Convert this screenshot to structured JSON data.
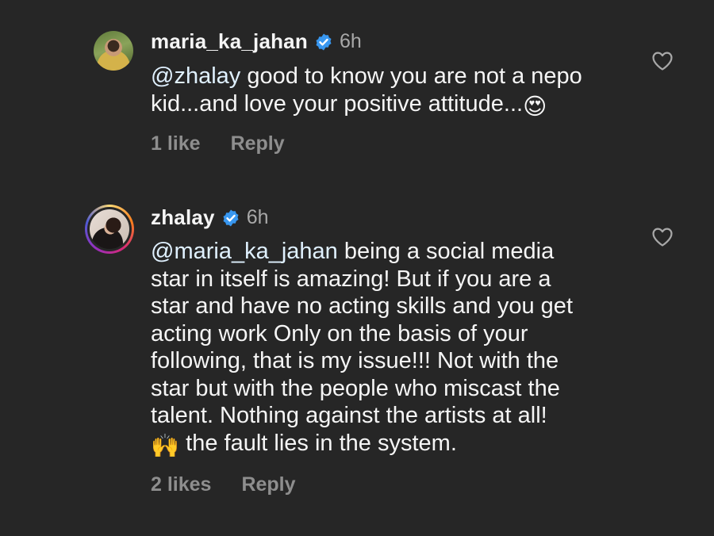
{
  "comments": [
    {
      "username": "maria_ka_jahan",
      "time": "6h",
      "mention": "@zhalay",
      "line1_rest": " good to know you are not a nepo",
      "line2": "kid...and love your positive attitude...",
      "emoji": "😍",
      "likes": "1 like",
      "reply": "Reply",
      "avatar_icon": "profile-photo",
      "heart_icon": "heart-outline-icon"
    },
    {
      "username": "zhalay",
      "time": "6h",
      "mention": "@maria_ka_jahan",
      "line1_rest": " being a social media",
      "lines": [
        "star in itself is amazing! But if you are a",
        "star and have no acting skills and you get",
        "acting work Only on the basis of your",
        "following, that is my issue!!! Not with the",
        "star but with the people who miscast the",
        "talent. Nothing against the artists at all!"
      ],
      "emoji": "🙌",
      "last_line": " the fault lies in the system.",
      "likes": "2 likes",
      "reply": "Reply",
      "avatar_icon": "profile-photo-story-ring",
      "heart_icon": "heart-outline-icon"
    }
  ],
  "colors": {
    "background": "#262626",
    "text": "#f5f5f5",
    "mention": "#e0f1ff",
    "secondary": "#8e8e8e",
    "verified": "#3897f0"
  }
}
